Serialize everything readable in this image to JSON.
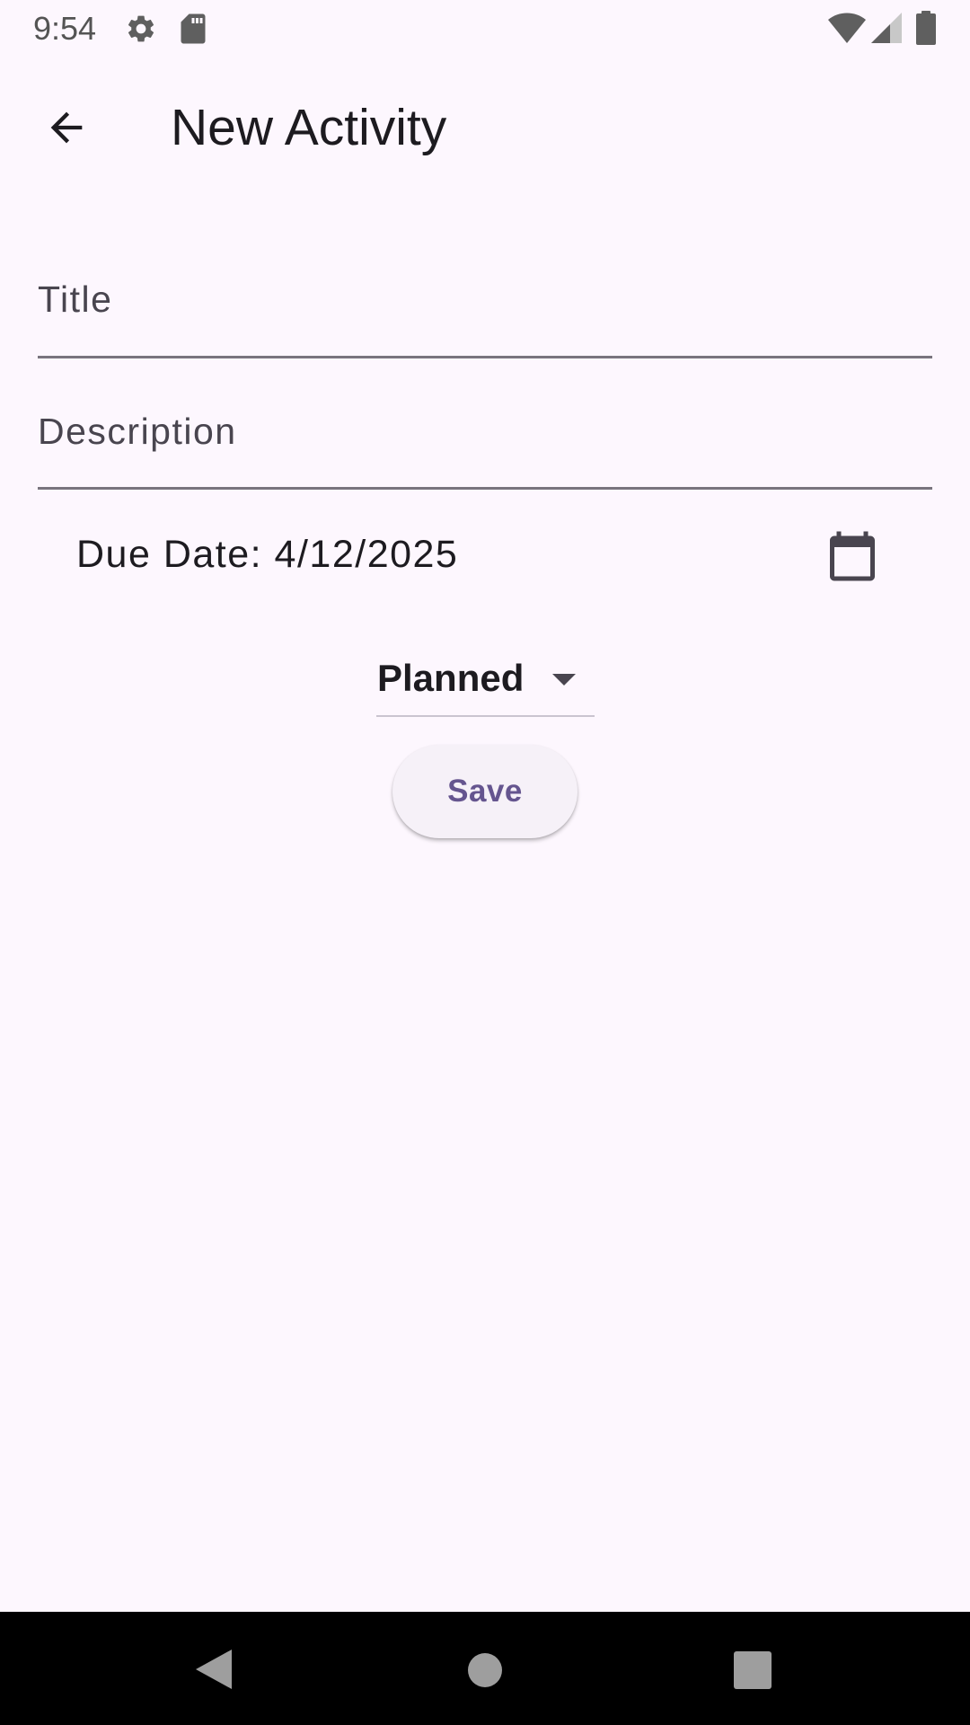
{
  "status_bar": {
    "time": "9:54",
    "icons": [
      "gear-icon",
      "sd-card-icon",
      "wifi-icon",
      "cell-signal-icon",
      "battery-icon"
    ]
  },
  "app_bar": {
    "title": "New Activity",
    "back_icon": "arrow-back-icon"
  },
  "form": {
    "title_field": {
      "placeholder": "Title",
      "value": ""
    },
    "description_field": {
      "placeholder": "Description",
      "value": ""
    },
    "due_date": {
      "text": "Due Date: 4/12/2025",
      "icon": "calendar-icon"
    },
    "status_dropdown": {
      "selected": "Planned",
      "icon": "dropdown-arrow-icon"
    },
    "save_label": "Save"
  },
  "nav_bar": {
    "buttons": [
      "back-triangle-icon",
      "home-circle-icon",
      "recents-square-icon"
    ]
  },
  "colors": {
    "background": "#fdf7fe",
    "primary": "#65558f",
    "on_surface": "#1d1b20",
    "outline": "#79747e",
    "button_surface": "#f6f1f8",
    "nav_bar": "#000000"
  }
}
